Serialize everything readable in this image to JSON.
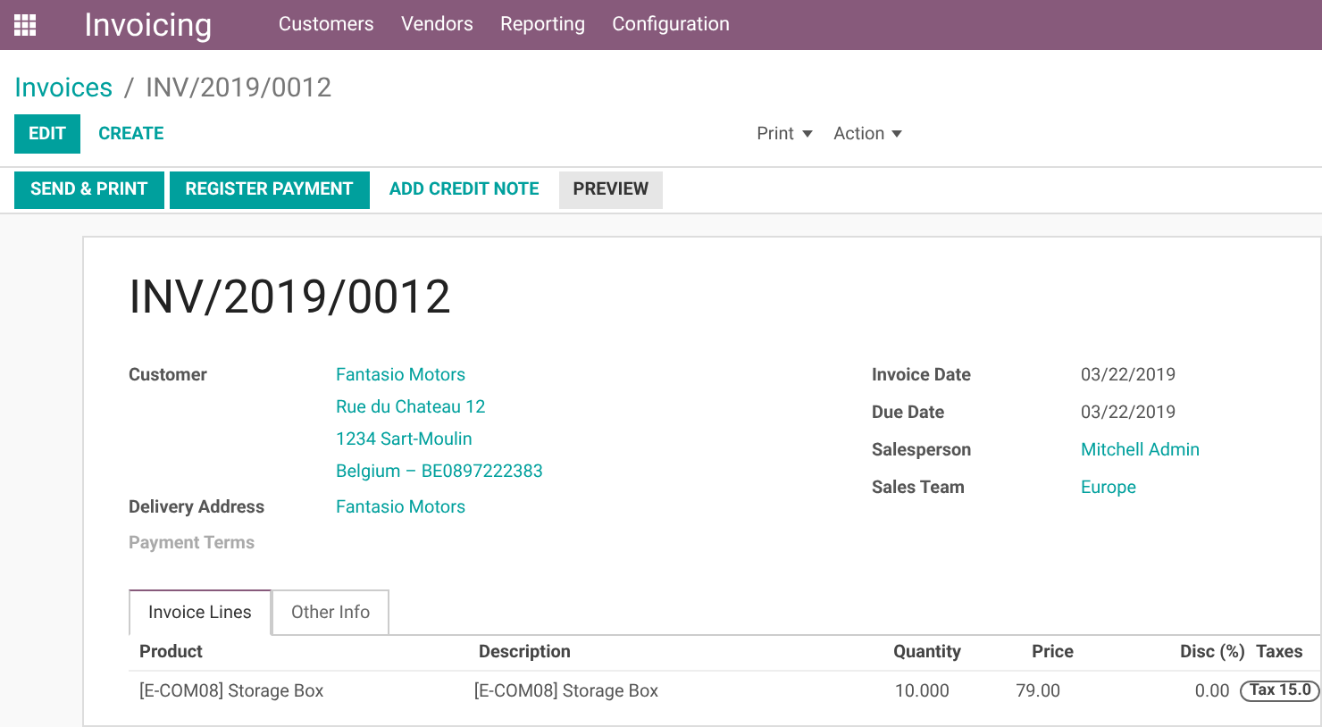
{
  "app_name": "Invoicing",
  "menu": [
    "Customers",
    "Vendors",
    "Reporting",
    "Configuration"
  ],
  "breadcrumb": {
    "parent": "Invoices",
    "separator": "/",
    "current": "INV/2019/0012"
  },
  "actions": {
    "edit": "EDIT",
    "create": "CREATE",
    "dropdowns": [
      "Print",
      "Action"
    ]
  },
  "status_buttons": [
    {
      "label": "SEND & PRINT",
      "kind": "primary"
    },
    {
      "label": "REGISTER PAYMENT",
      "kind": "primary"
    },
    {
      "label": "ADD CREDIT NOTE",
      "kind": "link"
    },
    {
      "label": "PREVIEW",
      "kind": "secondary"
    }
  ],
  "title": "INV/2019/0012",
  "left_fields": [
    {
      "label": "Customer",
      "values": [
        "Fantasio Motors",
        "Rue du Chateau 12",
        "1234 Sart-Moulin",
        "Belgium – BE0897222383"
      ],
      "muted": false
    },
    {
      "label": "Delivery Address",
      "values": [
        "Fantasio Motors"
      ],
      "muted": false
    },
    {
      "label": "Payment Terms",
      "muted": true
    }
  ],
  "right_fields": [
    {
      "label": "Invoice Date",
      "value": "03/22/2019",
      "kind": "text"
    },
    {
      "label": "Due Date",
      "value": "03/22/2019",
      "kind": "text"
    },
    {
      "label": "Salesperson",
      "value": "Mitchell Admin",
      "kind": "link"
    },
    {
      "label": "Sales Team",
      "value": "Europe",
      "kind": "link"
    }
  ],
  "tabs": [
    {
      "label": "Invoice Lines",
      "selected": true
    },
    {
      "label": "Other Info",
      "selected": false
    }
  ],
  "table": {
    "columns": [
      "Product",
      "Description",
      "Quantity",
      "Price",
      "Disc (%)",
      "Taxes"
    ],
    "rows": [
      {
        "product": "[E-COM08] Storage Box",
        "description": "[E-COM08] Storage Box",
        "quantity": "10.000",
        "price": "79.00",
        "discount": "0.00",
        "tax": "Tax 15.0"
      }
    ]
  }
}
